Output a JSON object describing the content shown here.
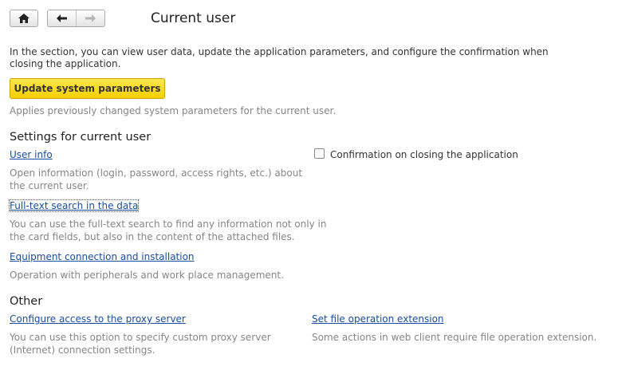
{
  "header": {
    "title": "Current user",
    "home_icon": "home-icon",
    "back_icon": "arrow-left-icon",
    "forward_icon": "arrow-right-icon"
  },
  "intro": {
    "description": "In the section, you can view user data, update the application parameters, and configure the confirmation when closing the application."
  },
  "update": {
    "button_label": "Update system parameters",
    "note": "Applies previously changed system parameters for the current user."
  },
  "settings": {
    "heading": "Settings for current user",
    "user_info": {
      "label": "User info",
      "description": "Open information (login, password, access rights, etc.) about the current user."
    },
    "fulltext": {
      "label": "Full-text search in the data",
      "description": "You can use the full-text search to find any information not only in the card fields, but also in the content of the attached files."
    },
    "equipment": {
      "label": "Equipment connection and installation",
      "description": "Operation with peripherals and work place management."
    },
    "confirmation": {
      "label": "Confirmation on closing the application",
      "checked": false
    }
  },
  "other": {
    "heading": "Other",
    "proxy": {
      "label": "Configure access to the proxy server",
      "description": "You can use this option to specify custom proxy server (Internet) connection settings."
    },
    "file_ext": {
      "label": "Set file operation extension",
      "description": "Some actions in web client require file operation extension."
    }
  },
  "colors": {
    "accent_button": "#f5cf00",
    "link": "#1a4da1",
    "note_text": "#868686"
  }
}
